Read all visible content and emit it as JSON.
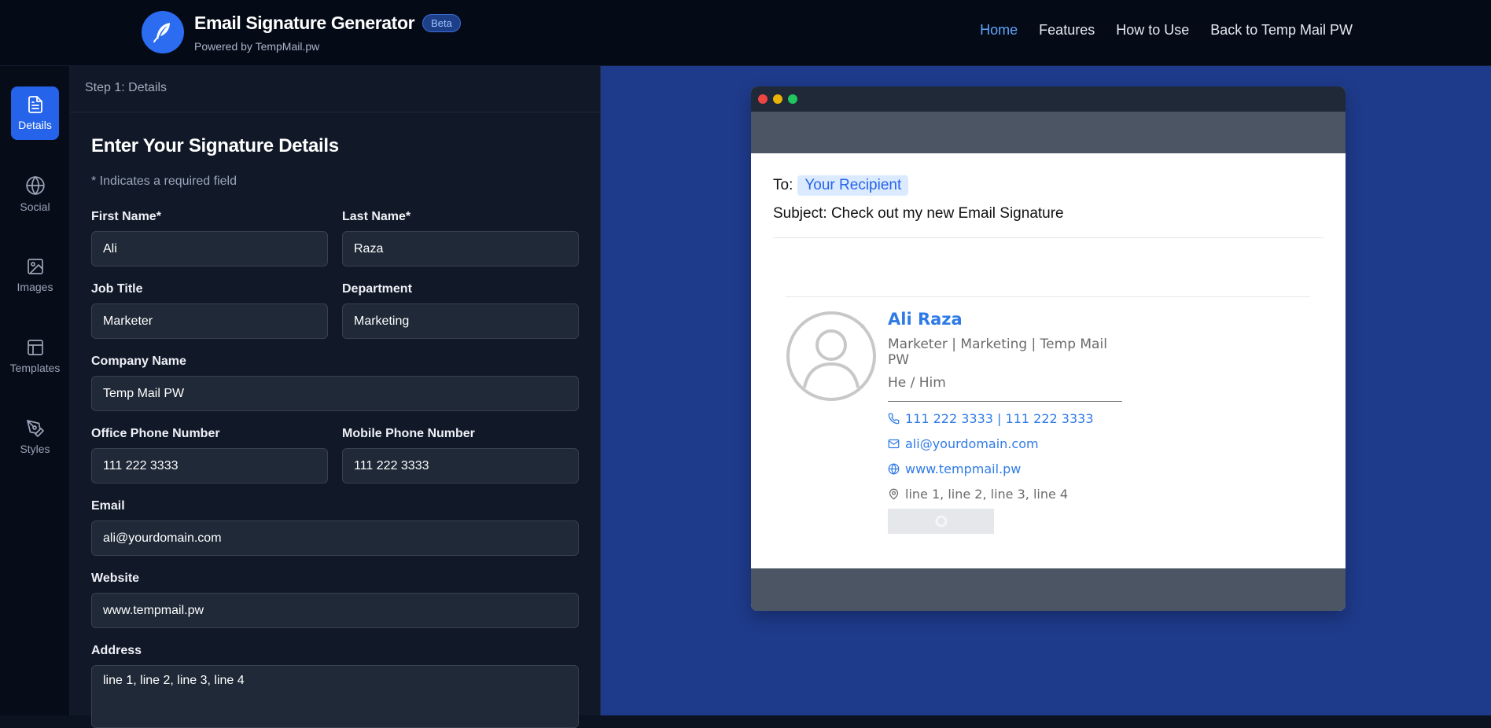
{
  "header": {
    "title": "Email Signature Generator",
    "badge": "Beta",
    "subtitle": "Powered by TempMail.pw",
    "nav": [
      "Home",
      "Features",
      "How to Use",
      "Back to Temp Mail PW"
    ],
    "active_nav": "Home"
  },
  "rail": {
    "items": [
      {
        "label": "Details",
        "icon": "document-icon",
        "active": true
      },
      {
        "label": "Social",
        "icon": "globe-icon",
        "active": false
      },
      {
        "label": "Images",
        "icon": "image-icon",
        "active": false
      },
      {
        "label": "Templates",
        "icon": "layout-icon",
        "active": false
      },
      {
        "label": "Styles",
        "icon": "pen-icon",
        "active": false
      }
    ]
  },
  "form": {
    "step": "Step 1: Details",
    "title": "Enter Your Signature Details",
    "required_note": "* Indicates a required field",
    "fields": {
      "first_name": {
        "label": "First Name*",
        "value": "Ali"
      },
      "last_name": {
        "label": "Last Name*",
        "value": "Raza"
      },
      "job_title": {
        "label": "Job Title",
        "value": "Marketer"
      },
      "department": {
        "label": "Department",
        "value": "Marketing"
      },
      "company": {
        "label": "Company Name",
        "value": "Temp Mail PW"
      },
      "office_phone": {
        "label": "Office Phone Number",
        "value": "111 222 3333"
      },
      "mobile_phone": {
        "label": "Mobile Phone Number",
        "value": "111 222 3333"
      },
      "email": {
        "label": "Email",
        "value": "ali@yourdomain.com"
      },
      "website": {
        "label": "Website",
        "value": "www.tempmail.pw"
      },
      "address": {
        "label": "Address",
        "value": "line 1, line 2, line 3, line 4"
      }
    }
  },
  "preview": {
    "to_label": "To:",
    "recipient": "Your Recipient",
    "subject_label": "Subject:",
    "subject": "Check out my new Email Signature",
    "signature": {
      "name": "Ali Raza",
      "role_line": "Marketer | Marketing | Temp Mail PW",
      "pronouns": "He / Him",
      "phones": "111 222 3333 | 111 222 3333",
      "email": "ali@yourdomain.com",
      "website": "www.tempmail.pw",
      "address": "line 1, line 2, line 3, line 4"
    }
  },
  "colors": {
    "accent": "#2563eb",
    "link": "#60a5fa",
    "preview_bg": "#1e3a8a",
    "signature_blue": "#2f7be6"
  }
}
